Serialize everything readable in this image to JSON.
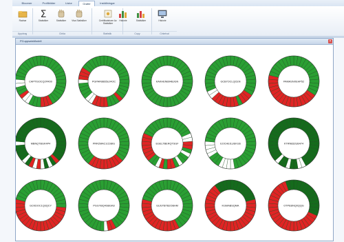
{
  "ribbon": {
    "tabs": [
      {
        "label": "Bloomer",
        "active": false
      },
      {
        "label": "Profilbilder",
        "active": false
      },
      {
        "label": "Listor",
        "active": false
      },
      {
        "label": "Grafer",
        "active": true
      },
      {
        "label": "Inställningar",
        "active": false
      }
    ],
    "buttons": [
      {
        "label": "Radnar",
        "icon": "folder-icon"
      },
      {
        "label": "Statistiker",
        "icon": "sigma-icon"
      },
      {
        "label": "Statistiker",
        "icon": "hand-icon"
      },
      {
        "label": "Visa Statistiker",
        "icon": "hand-icon"
      },
      {
        "label": "Certifikatshare Av. Statistiker",
        "icon": "certificate-icon"
      },
      {
        "label": "Historie",
        "icon": "bar-chart-icon"
      },
      {
        "label": "Statistiker",
        "icon": "bar-chart-icon"
      },
      {
        "label": "Historie",
        "icon": "monitor-icon"
      }
    ],
    "groups": [
      {
        "label": "Uppdrag"
      },
      {
        "label": "Cirkla"
      },
      {
        "label": "Statistik"
      },
      {
        "label": "Copy"
      },
      {
        "label": "Cirkelval"
      }
    ]
  },
  "window": {
    "title": "PCuppsatsModell",
    "close_label": "×"
  },
  "colors": {
    "green": "#2a9f33",
    "dark_green": "#156b1c",
    "red": "#e02424",
    "white": "#ffffff",
    "stroke": "#1d4a1f"
  },
  "donuts": [
    {
      "label": "CAPTISOCQ2FR00",
      "segments": "GGGGGGGGGGGGGGGGRRRGGGWWRGGWWGGGGGGGGG",
      "tone": "light"
    },
    {
      "label": "PGPAFBB65UJ4OC",
      "segments": "GGGGGGGGGGGGGGRGGGRRRRWWGGGGWRRRGGGGGG",
      "tone": "light"
    },
    {
      "label": "KAKHENB94BJGN",
      "segments": "GGGGGGGGGGGGGGGGGGGGGGGGGGGGGGGGGGGGGG",
      "tone": "light"
    },
    {
      "label": "GCB7OCLQCEN",
      "segments": "GGGGGGGGGGGGGRRRGRRRRRRRWWGGGGGGGGGGGG",
      "tone": "light"
    },
    {
      "label": "PAMASNXEHP52",
      "segments": "GGGGGGGGGGGGGRRRRRRRRRRRRRRRRRGGGGGGGG",
      "tone": "light"
    },
    {
      "label": "MBNQTBGK4P4",
      "segments": "GGGGGGGGGGGGGGRGWGWRWRGWGGGGWGGGGGGGGG",
      "tone": "dark"
    },
    {
      "label": "PRR2MAC1CD8IG",
      "segments": "GGGGGGGGGGGGGGRRRRRRRRRGGGGGGGGGGGGGGG",
      "tone": "light"
    },
    {
      "label": "EGELTBERQTSGF",
      "segments": "GGGGGGGWWRRGWGGWGRRGRWGGRRRRRRRGGGGGGG",
      "tone": "light"
    },
    {
      "label": "EOCHEI1UEKG6",
      "segments": "GGGGGGGGGGGGGGGGGGWWWWGGGWWWWGGGGGGGGG",
      "tone": "light"
    },
    {
      "label": "KTRN832UB474",
      "segments": "GGGGGGGGGGGGGGGGWWGGWGGWGGGGGGGGGGGGGG",
      "tone": "dark"
    },
    {
      "label": "GCKDOC1Q3QCY",
      "segments": "GGGGGGGGGGRRRRRRRRRRRRRRRRRRRRGGGGGGGG",
      "tone": "light"
    },
    {
      "label": "PGGYBQ4SBGK8",
      "segments": "GGGGGGGGGGGGGGGGRRWGGGGGGGGGGGGGGGGGGG",
      "tone": "light"
    },
    {
      "label": "GUGTBTB2OBHM",
      "segments": "GGGGGGGGGGGGGGGGRRRRRRRRRRRRRRGGGGGGGG",
      "tone": "light"
    },
    {
      "label": "KGMABSQMA",
      "segments": "GGGGGGGGRRRRRRRRRRRRRRRRRRRRRRRRRRGGGG",
      "tone": "dark"
    },
    {
      "label": "OTPEBNQ0QQG",
      "segments": "GGGGGGGGGGGGRRRRRRRRRRRRRRRRRRRRRRRRGG",
      "tone": "dark"
    }
  ]
}
